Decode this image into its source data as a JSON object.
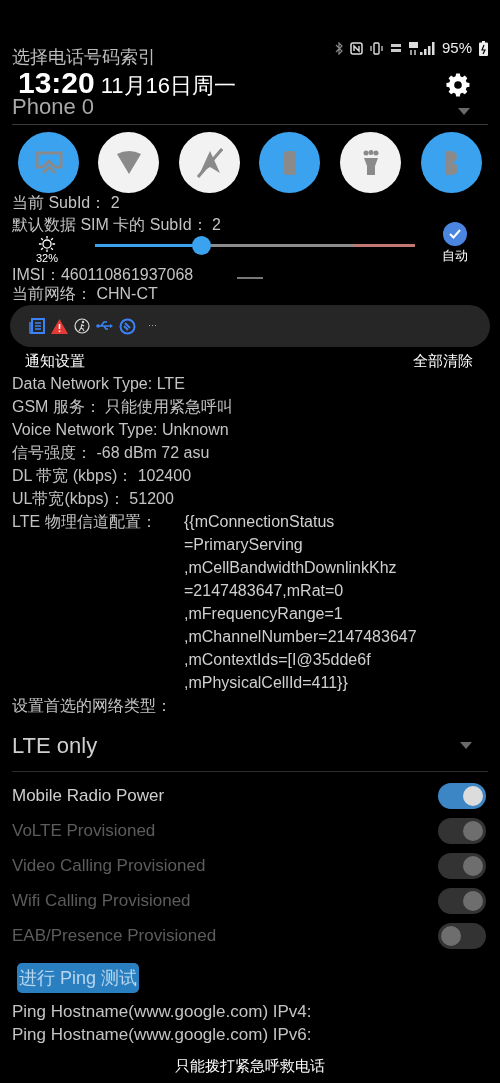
{
  "app": {
    "title": "选择电话号码索引",
    "phone_spinner": "Phone 0",
    "rows_a": [
      "当前 SubId： 2",
      "默认数据 SIM 卡的 SubId： 2",
      "IMSI：460110861937068",
      "当前网络： CHN-CT"
    ],
    "rows_b": [
      "Data Network Type: LTE",
      "GSM 服务： 只能使用紧急呼叫",
      "Voice Network Type: Unknown",
      "信号强度： -68 dBm   72 asu",
      "DL 带宽 (kbps)： 102400",
      "UL带宽(kbps)： 51200"
    ],
    "physical_channel": {
      "label": "LTE 物理信道配置：",
      "lines": [
        "{{mConnectionStatus",
        "=PrimaryServing",
        ",mCellBandwidthDownlinkKhz",
        "=2147483647,mRat=0",
        ",mFrequencyRange=1",
        ",mChannelNumber=2147483647",
        ",mContextIds=[I@35dde6f",
        ",mPhysicalCellId=411}}"
      ]
    },
    "preferred_label": "设置首选的网络类型：",
    "preferred_value": "LTE only",
    "switches": [
      {
        "label": "Mobile Radio Power",
        "on": true,
        "disabled": false
      },
      {
        "label": "VoLTE Provisioned",
        "on": true,
        "disabled": true
      },
      {
        "label": "Video Calling Provisioned",
        "on": true,
        "disabled": true
      },
      {
        "label": "Wifi Calling Provisioned",
        "on": true,
        "disabled": true
      },
      {
        "label": "EAB/Presence Provisioned",
        "on": false,
        "disabled": true
      }
    ],
    "ping_button": "进行 Ping 测试",
    "ping_lines": [
      "Ping Hostname(www.google.com) IPv4:",
      "Ping Hostname(www.google.com) IPv6:"
    ]
  },
  "shade": {
    "battery": "95%",
    "clock": "13:20",
    "date": "11月16日周一",
    "toggles": [
      {
        "on": true
      },
      {
        "on": false
      },
      {
        "on": false
      },
      {
        "on": true
      },
      {
        "on": false
      },
      {
        "on": true
      }
    ],
    "brightness": {
      "level": 0.33,
      "reading": "32%"
    },
    "auto": {
      "label": "自动",
      "checked": true
    },
    "more": "···",
    "notification_settings": "通知设置",
    "clear_all": "全部清除"
  },
  "toast": "只能拨打紧急呼救电话"
}
